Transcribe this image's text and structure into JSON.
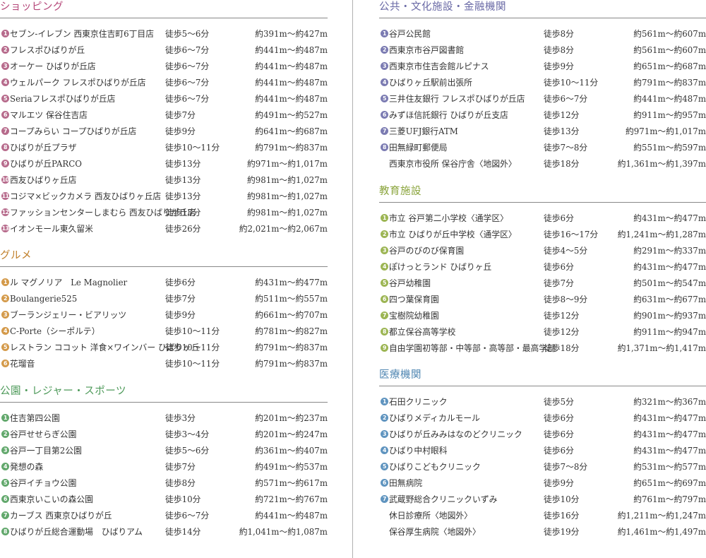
{
  "sections": {
    "shopping": {
      "title": "ショッピング",
      "items": [
        {
          "no": "1",
          "name": "セブン-イレブン 西東京住吉町6丁目店",
          "walk": "徒歩5～6分",
          "dist": "約391m～約427m"
        },
        {
          "no": "2",
          "name": "フレスポひばりが丘",
          "walk": "徒歩6～7分",
          "dist": "約441m～約487m"
        },
        {
          "no": "3",
          "name": "オーケー ひばりが丘店",
          "walk": "徒歩6～7分",
          "dist": "約441m～約487m"
        },
        {
          "no": "4",
          "name": "ウェルパーク フレスポひばりが丘店",
          "walk": "徒歩6～7分",
          "dist": "約441m～約487m"
        },
        {
          "no": "5",
          "name": "Seriaフレスポひばりが丘店",
          "walk": "徒歩6～7分",
          "dist": "約441m～約487m"
        },
        {
          "no": "6",
          "name": "マルエツ 保谷住吉店",
          "walk": "徒歩7分",
          "dist": "約491m～約527m"
        },
        {
          "no": "7",
          "name": "コープみらい コープひばりが丘店",
          "walk": "徒歩9分",
          "dist": "約641m～約687m"
        },
        {
          "no": "8",
          "name": "ひばりが丘プラザ",
          "walk": "徒歩10～11分",
          "dist": "約791m～約837m"
        },
        {
          "no": "9",
          "name": "ひばりが丘PARCO",
          "walk": "徒歩13分",
          "dist": "約971m～約1,017m"
        },
        {
          "no": "10",
          "name": "西友ひばりヶ丘店",
          "walk": "徒歩13分",
          "dist": "約981m～約1,027m"
        },
        {
          "no": "11",
          "name": "コジマ×ビックカメラ 西友ひばりヶ丘店",
          "walk": "徒歩13分",
          "dist": "約981m～約1,027m"
        },
        {
          "no": "12",
          "name": "ファッションセンターしまむら 西友ひばりが丘店",
          "walk": "徒歩13分",
          "dist": "約981m～約1,027m"
        },
        {
          "no": "13",
          "name": "イオンモール東久留米",
          "walk": "徒歩26分",
          "dist": "約2,021m～約2,067m"
        }
      ]
    },
    "gourmet": {
      "title": "グルメ",
      "items": [
        {
          "no": "1",
          "name": "ル マグノリア　Le Magnolier",
          "walk": "徒歩6分",
          "dist": "約431m～約477m"
        },
        {
          "no": "2",
          "name": "Boulangerie525",
          "walk": "徒歩7分",
          "dist": "約511m～約557m"
        },
        {
          "no": "3",
          "name": "ブーランジェリー・ビアリッツ",
          "walk": "徒歩9分",
          "dist": "約661m～約707m"
        },
        {
          "no": "4",
          "name": "C-Porte（シーポルテ）",
          "walk": "徒歩10～11分",
          "dist": "約781m～約827m"
        },
        {
          "no": "5",
          "name": "レストラン ココット 洋食×ワインバー ひばりヶ丘",
          "walk": "徒歩10～11分",
          "dist": "約791m～約837m"
        },
        {
          "no": "6",
          "name": "花瑠音",
          "walk": "徒歩10～11分",
          "dist": "約791m～約837m"
        }
      ]
    },
    "parks": {
      "title": "公園・レジャー・スポーツ",
      "items": [
        {
          "no": "1",
          "name": "住吉第四公園",
          "walk": "徒歩3分",
          "dist": "約201m～約237m"
        },
        {
          "no": "2",
          "name": "谷戸せせらぎ公園",
          "walk": "徒歩3～4分",
          "dist": "約201m～約247m"
        },
        {
          "no": "3",
          "name": "谷戸一丁目第2公園",
          "walk": "徒歩5～6分",
          "dist": "約361m～約407m"
        },
        {
          "no": "4",
          "name": "発想の森",
          "walk": "徒歩7分",
          "dist": "約491m～約537m"
        },
        {
          "no": "5",
          "name": "谷戸イチョウ公園",
          "walk": "徒歩8分",
          "dist": "約571m～約617m"
        },
        {
          "no": "6",
          "name": "西東京いこいの森公園",
          "walk": "徒歩10分",
          "dist": "約721m～約767m"
        },
        {
          "no": "7",
          "name": "カーブス 西東京ひばりが丘",
          "walk": "徒歩6～7分",
          "dist": "約441m～約487m"
        },
        {
          "no": "8",
          "name": "ひばりが丘総合運動場　ひばりアム",
          "walk": "徒歩14分",
          "dist": "約1,041m～約1,087m"
        }
      ]
    },
    "public": {
      "title": "公共・文化施設・金融機関",
      "items": [
        {
          "no": "1",
          "name": "谷戸公民館",
          "walk": "徒歩8分",
          "dist": "約561m～約607m"
        },
        {
          "no": "2",
          "name": "西東京市谷戸図書館",
          "walk": "徒歩8分",
          "dist": "約561m～約607m"
        },
        {
          "no": "3",
          "name": "西東京市住吉会館ルピナス",
          "walk": "徒歩9分",
          "dist": "約651m～約687m"
        },
        {
          "no": "4",
          "name": "ひばりヶ丘駅前出張所",
          "walk": "徒歩10～11分",
          "dist": "約791m～約837m"
        },
        {
          "no": "5",
          "name": "三井住友銀行 フレスポひばりが丘店",
          "walk": "徒歩6～7分",
          "dist": "約441m～約487m"
        },
        {
          "no": "6",
          "name": "みずほ信託銀行 ひばりが丘支店",
          "walk": "徒歩12分",
          "dist": "約911m～約957m"
        },
        {
          "no": "7",
          "name": "三菱UFJ銀行ATM",
          "walk": "徒歩13分",
          "dist": "約971m～約1,017m"
        },
        {
          "no": "8",
          "name": "田無緑町郵便局",
          "walk": "徒歩7～8分",
          "dist": "約551m～約597m"
        },
        {
          "no": "",
          "name": "西東京市役所 保谷庁舎〈地図外〉",
          "walk": "徒歩18分",
          "dist": "約1,361m～約1,397m"
        }
      ]
    },
    "education": {
      "title": "教育施設",
      "items": [
        {
          "no": "1",
          "name": "市立 谷戸第二小学校〈通学区〉",
          "walk": "徒歩6分",
          "dist": "約431m～約477m"
        },
        {
          "no": "2",
          "name": "市立 ひばりが丘中学校〈通学区〉",
          "walk": "徒歩16～17分",
          "dist": "約1,241m～約1,287m"
        },
        {
          "no": "3",
          "name": "谷戸のびのび保育園",
          "walk": "徒歩4～5分",
          "dist": "約291m～約337m"
        },
        {
          "no": "4",
          "name": "ぽけっとランド ひばりヶ丘",
          "walk": "徒歩6分",
          "dist": "約431m～約477m"
        },
        {
          "no": "5",
          "name": "谷戸幼稚園",
          "walk": "徒歩7分",
          "dist": "約501m～約547m"
        },
        {
          "no": "6",
          "name": "四つ葉保育園",
          "walk": "徒歩8～9分",
          "dist": "約631m～約677m"
        },
        {
          "no": "7",
          "name": "宝樹院幼稚園",
          "walk": "徒歩12分",
          "dist": "約901m～約937m"
        },
        {
          "no": "8",
          "name": "都立保谷高等学校",
          "walk": "徒歩12分",
          "dist": "約911m～約947m"
        },
        {
          "no": "9",
          "name": "自由学園初等部・中等部・高等部・最高学部",
          "walk": "徒歩18分",
          "dist": "約1,371m～約1,417m"
        }
      ]
    },
    "medical": {
      "title": "医療機関",
      "items": [
        {
          "no": "1",
          "name": "石田クリニック",
          "walk": "徒歩5分",
          "dist": "約321m～約367m"
        },
        {
          "no": "2",
          "name": "ひばりメディカルモール",
          "walk": "徒歩6分",
          "dist": "約431m～約477m"
        },
        {
          "no": "3",
          "name": "ひばりが丘みみはなのどクリニック",
          "walk": "徒歩6分",
          "dist": "約431m～約477m"
        },
        {
          "no": "4",
          "name": "ひばり中村眼科",
          "walk": "徒歩6分",
          "dist": "約431m～約477m"
        },
        {
          "no": "5",
          "name": "ひばりこどもクリニック",
          "walk": "徒歩7～8分",
          "dist": "約531m～約577m"
        },
        {
          "no": "6",
          "name": "田無病院",
          "walk": "徒歩9分",
          "dist": "約651m～約697m"
        },
        {
          "no": "7",
          "name": "武蔵野総合クリニックいずみ",
          "walk": "徒歩10分",
          "dist": "約761m～約797m"
        },
        {
          "no": "",
          "name": "休日診療所〈地図外〉",
          "walk": "徒歩16分",
          "dist": "約1,211m～約1,247m"
        },
        {
          "no": "",
          "name": "保谷厚生病院〈地図外〉",
          "walk": "徒歩19分",
          "dist": "約1,461m～約1,497m"
        }
      ]
    }
  }
}
